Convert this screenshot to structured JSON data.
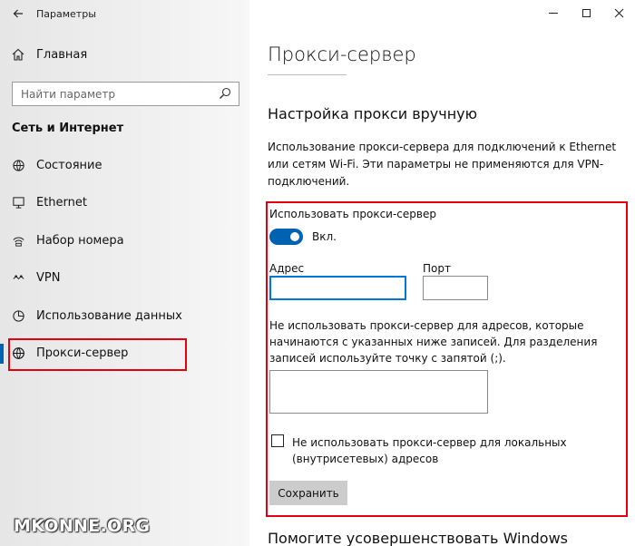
{
  "window": {
    "app_title": "Параметры",
    "back_icon": "arrow-left-icon",
    "controls": [
      "minimize-icon",
      "maximize-icon",
      "close-icon"
    ]
  },
  "sidebar": {
    "home_label": "Главная",
    "search_placeholder": "Найти параметр",
    "section_title": "Сеть и Интернет",
    "items": [
      {
        "label": "Состояние",
        "icon": "status-globe-icon"
      },
      {
        "label": "Ethernet",
        "icon": "ethernet-icon"
      },
      {
        "label": "Набор номера",
        "icon": "dial-up-icon"
      },
      {
        "label": "VPN",
        "icon": "vpn-icon"
      },
      {
        "label": "Использование данных",
        "icon": "data-usage-icon"
      },
      {
        "label": "Прокси-сервер",
        "icon": "globe-icon",
        "selected": true
      }
    ]
  },
  "main": {
    "page_title": "Прокси-сервер",
    "section_title": "Настройка прокси вручную",
    "description": "Использование прокси-сервера для подключений к Ethernet или сетям Wi-Fi. Эти параметры не применяются для VPN-подключений.",
    "use_proxy_label": "Использовать прокси-сервер",
    "toggle_state": "Вкл.",
    "address_label": "Адрес",
    "address_value": "",
    "port_label": "Порт",
    "port_value": "",
    "exceptions_description": "Не использовать прокси-сервер для адресов, которые начинаются с указанных ниже записей. Для разделения записей используйте точку с запятой (;).",
    "exceptions_value": "",
    "local_checkbox_label": "Не использовать прокси-сервер для локальных (внутрисетевых) адресов",
    "local_checkbox_checked": false,
    "save_label": "Сохранить",
    "footer_title": "Помогите усовершенствовать Windows"
  },
  "watermark": "MKONNE.ORG",
  "colors": {
    "accent": "#0063b1",
    "highlight_red": "#e3000f"
  }
}
